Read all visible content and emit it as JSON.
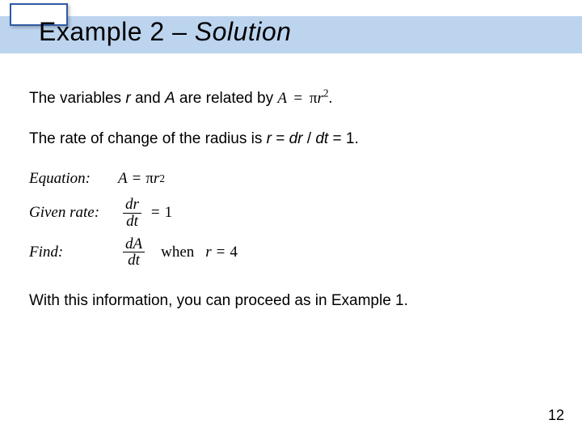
{
  "title": {
    "prefix": "Example 2 – ",
    "emph": "Solution"
  },
  "line1": {
    "pre": "The variables ",
    "var_r": "r",
    "mid1": " and ",
    "var_A": "A",
    "mid2": " are related by ",
    "eq_A": "A",
    "eq_eq": "=",
    "eq_pi": "π",
    "eq_r": "r",
    "eq_sq": "2",
    "eq_dot": "."
  },
  "line2": {
    "pre": "The rate of change of the radius is ",
    "r": "r",
    "eq": " = ",
    "dr": "dr",
    "slash": " / ",
    "dt": "dt",
    "tail": " = 1."
  },
  "serif": {
    "equation_label": "Equation:",
    "equation_A": "A",
    "equation_eq": "=",
    "equation_pi": "π",
    "equation_r": "r",
    "equation_sq": "2",
    "given_label": "Given rate:",
    "given_num": "dr",
    "given_den": "dt",
    "given_eq": "=",
    "given_val": "1",
    "find_label": "Find:",
    "find_num": "dA",
    "find_den": "dt",
    "find_when": "when",
    "find_r": "r",
    "find_eq": "=",
    "find_val": "4"
  },
  "closing": "With this information, you can proceed as in Example 1.",
  "page_number": "12"
}
